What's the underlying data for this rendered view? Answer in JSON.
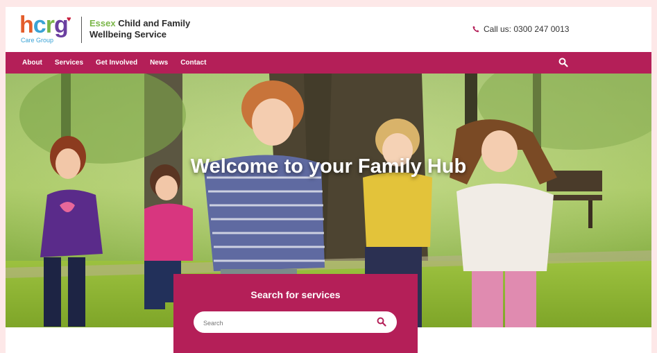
{
  "header": {
    "logo": {
      "word": "hcrg",
      "sub": "Care Group"
    },
    "title_accent": "Essex",
    "title_rest_line1": "Child and Family",
    "title_line2": "Wellbeing Service",
    "phone_text": "Call us: 0300 247 0013"
  },
  "nav": {
    "items": [
      {
        "label": "About"
      },
      {
        "label": "Services"
      },
      {
        "label": "Get Involved"
      },
      {
        "label": "News"
      },
      {
        "label": "Contact"
      }
    ],
    "search_icon": "search-icon"
  },
  "hero": {
    "heading": "Welcome to your Family Hub"
  },
  "search": {
    "title": "Search for services",
    "placeholder": "Search",
    "value": ""
  },
  "colors": {
    "brand": "#b41f58",
    "background": "#fde8e8",
    "logo_orange": "#e35d2b",
    "logo_blue": "#3aa3d6",
    "logo_green": "#7ab648",
    "logo_purple": "#6b3fa0"
  }
}
